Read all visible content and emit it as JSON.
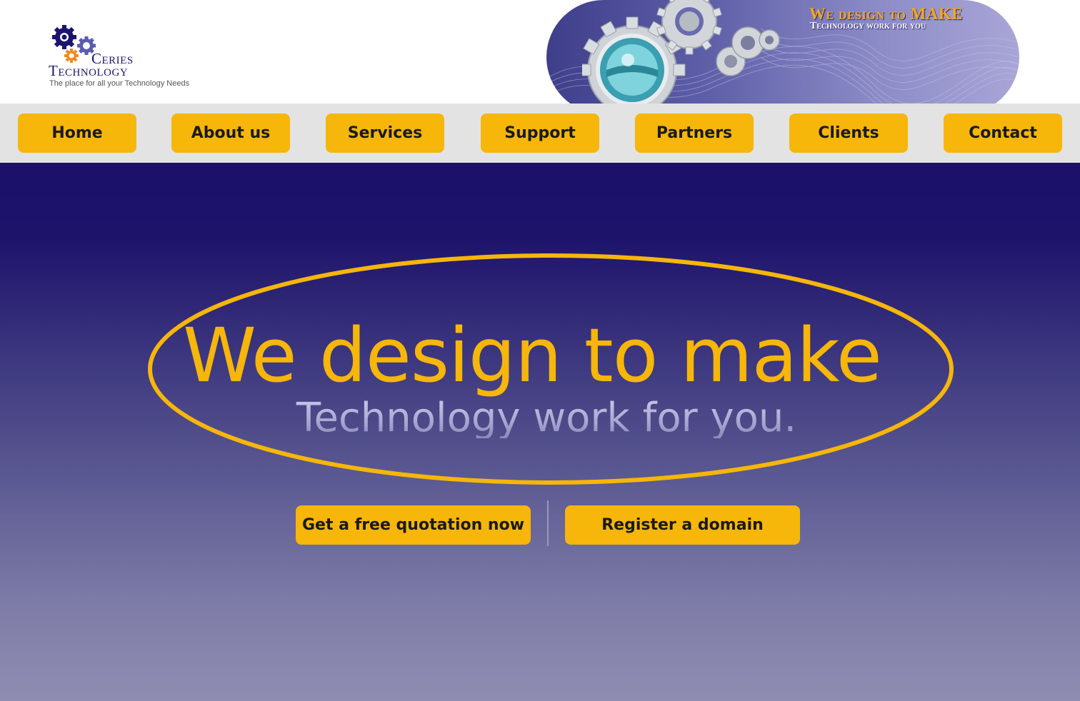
{
  "brand": {
    "name_line1": "Ceries",
    "name_line2": "Technology",
    "tagline": "The place for all your Technology Needs"
  },
  "banner": {
    "title": "We design to MAKE",
    "subtitle": "Technology work for you"
  },
  "nav": {
    "items": [
      {
        "label": "Home"
      },
      {
        "label": "About us"
      },
      {
        "label": "Services"
      },
      {
        "label": "Support"
      },
      {
        "label": "Partners"
      },
      {
        "label": "Clients"
      },
      {
        "label": "Contact"
      }
    ]
  },
  "hero": {
    "headline": "We design to make",
    "subheadline": "Technology work for you.",
    "cta_primary": "Get a free quotation now",
    "cta_secondary": "Register a domain"
  },
  "colors": {
    "accent": "#f6b60a",
    "brand_navy": "#1b106a",
    "nav_bg": "#e3e3e3"
  },
  "icons": {
    "logo": "gears-logo-icon",
    "banner": "gears-illustration-icon"
  }
}
